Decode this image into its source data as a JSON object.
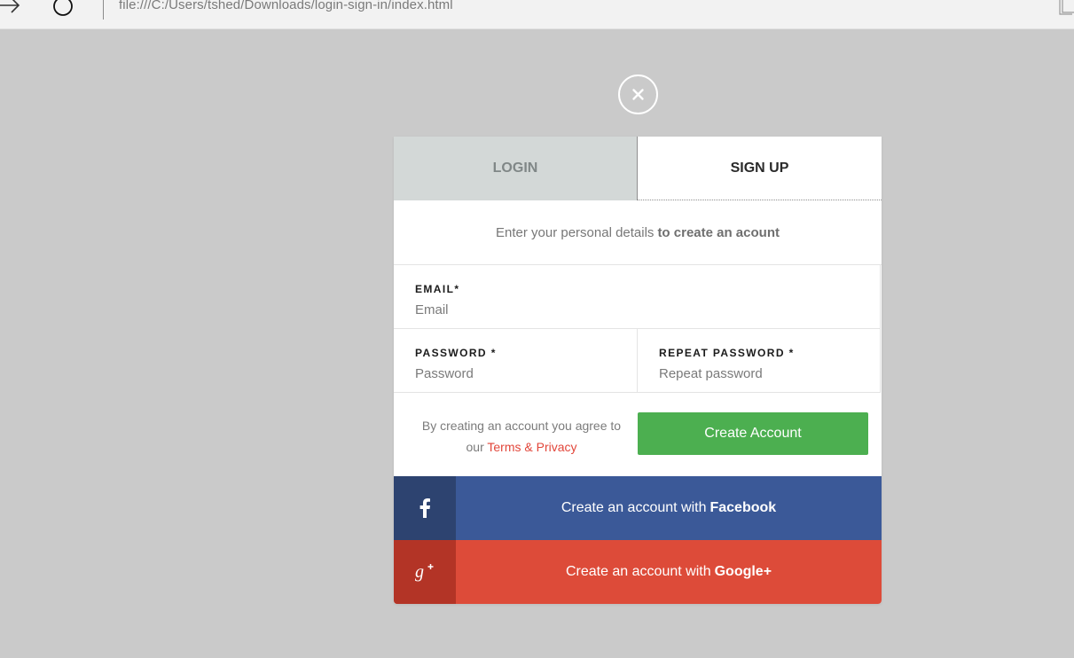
{
  "browser": {
    "address": "file:///C:/Users/tshed/Downloads/login-sign-in/index.html",
    "icons": [
      "forward-arrow-icon",
      "refresh-icon",
      "reading-view-icon"
    ]
  },
  "modal": {
    "close_icon": "close-icon",
    "tabs": [
      {
        "label": "LOGIN",
        "active": false
      },
      {
        "label": "SIGN UP",
        "active": true
      }
    ],
    "intro": {
      "text": "Enter your personal details",
      "bold": "to create an acount"
    },
    "fields": {
      "email": {
        "label": "EMAIL*",
        "placeholder": "Email",
        "value": ""
      },
      "password": {
        "label": "PASSWORD *",
        "placeholder": "Password",
        "value": ""
      },
      "repeat_password": {
        "label": "REPEAT PASSWORD *",
        "placeholder": "Repeat password",
        "value": ""
      }
    },
    "agreement": {
      "text_line1": "By creating an account you agree to",
      "text_prefix": "our",
      "link": "Terms & Privacy"
    },
    "create_button": "Create Account",
    "social": {
      "facebook": {
        "text": "Create an account with",
        "brand": "Facebook",
        "icon": "facebook-icon"
      },
      "google": {
        "text": "Create an account with",
        "brand": "Google+",
        "icon": "google-plus-icon"
      }
    }
  },
  "colors": {
    "background": "#cacaca",
    "login_tab": "#d3d8d7",
    "create_button": "#4caf50",
    "facebook": "#3b5998",
    "facebook_dark": "#2d4370",
    "google": "#dd4b39",
    "google_dark": "#b33426",
    "link": "#e2463a"
  }
}
